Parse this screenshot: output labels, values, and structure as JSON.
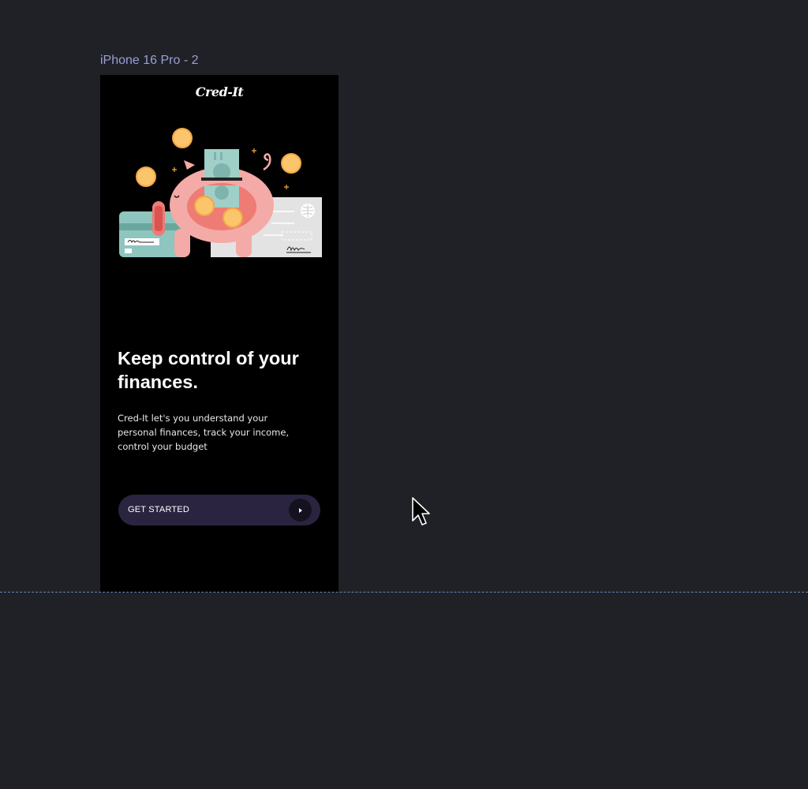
{
  "canvas": {
    "background": "#1f2127",
    "frame_label": "iPhone 16 Pro - 2"
  },
  "screen": {
    "logo": "Cred-It",
    "illustration": {
      "icon": "piggy-bank-with-coins-cheque-and-card-illustration",
      "colors": {
        "pig": "#f4aaa6",
        "pig_belly": "#ee7b74",
        "coin": "#fbc56b",
        "cash": "#9fcfc7",
        "card": "#8ec5bf",
        "cheque": "#e3e3e3"
      }
    },
    "headline": "Keep control of your finances.",
    "description": "Cred-It let's you understand your personal finances, track your income, control your budget",
    "cta": {
      "label": "GET STARTED",
      "icon": "play-arrow-icon",
      "background": "#2a2440"
    }
  },
  "pointer": {
    "icon": "mouse-pointer-icon"
  }
}
